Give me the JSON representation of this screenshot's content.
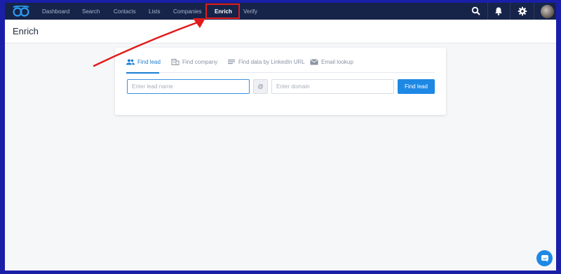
{
  "nav": {
    "items": [
      {
        "label": "Dashboard",
        "active": false
      },
      {
        "label": "Search",
        "active": false
      },
      {
        "label": "Contacts",
        "active": false
      },
      {
        "label": "Lists",
        "active": false
      },
      {
        "label": "Companies",
        "active": false
      },
      {
        "label": "Enrich",
        "active": true
      },
      {
        "label": "Verify",
        "active": false
      }
    ],
    "icons": [
      "search-icon",
      "bell-icon",
      "gear-icon"
    ]
  },
  "page": {
    "title": "Enrich"
  },
  "tabs": [
    {
      "label": "Find lead",
      "icon": "people-icon",
      "active": true
    },
    {
      "label": "Find company",
      "icon": "building-icon",
      "active": false
    },
    {
      "label": "Find data by LinkedIn URL",
      "icon": "list-icon",
      "active": false
    },
    {
      "label": "Email lookup",
      "icon": "envelope-icon",
      "active": false
    }
  ],
  "form": {
    "lead_placeholder": "Enter lead name",
    "lead_value": "",
    "at_symbol": "@",
    "domain_placeholder": "Enter domain",
    "domain_value": "",
    "submit_label": "Find lead"
  },
  "colors": {
    "accent": "#1e88e5",
    "nav_bg": "#16244a",
    "annotation": "#e21b1b"
  }
}
